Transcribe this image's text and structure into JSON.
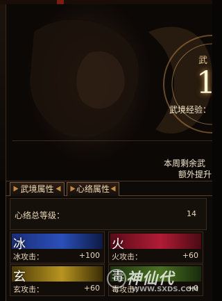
{
  "hero": {
    "label_wu": "武",
    "big_number": "1",
    "exp_label": "武境经验：",
    "weekly_remaining": "本周剩余武",
    "extra_boost": "额外提升"
  },
  "tabs": [
    {
      "label": "武境属性"
    },
    {
      "label": "心络属性"
    }
  ],
  "level": {
    "label": "心络总等级：",
    "value": "14"
  },
  "elements": [
    {
      "glyph": "冰",
      "label": "冰攻击：",
      "value": "+100",
      "color": "#2a4fb8"
    },
    {
      "glyph": "火",
      "label": "火攻击：",
      "value": "+60",
      "color": "#b01c34"
    },
    {
      "glyph": "玄",
      "label": "玄攻击：",
      "value": "+60",
      "color": "#b89420"
    },
    {
      "glyph": "毒",
      "label": "毒攻击：",
      "value": "+0",
      "color": "#4a7022"
    }
  ],
  "watermark": {
    "name": "神仙代",
    "url": "WWW.SXDS.COM"
  }
}
